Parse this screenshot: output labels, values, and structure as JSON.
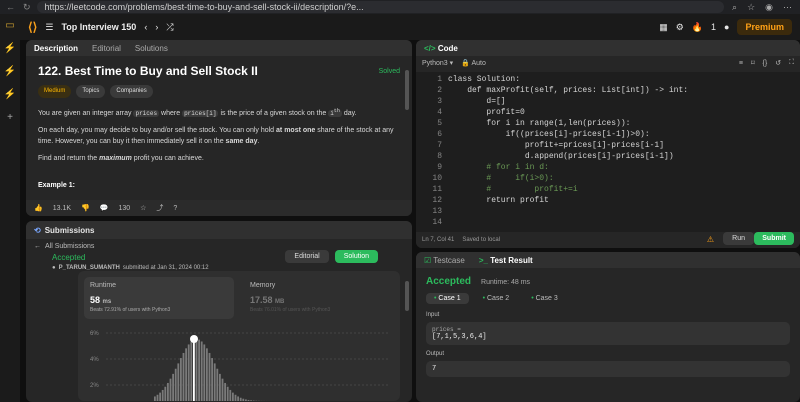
{
  "browser": {
    "url": "https://leetcode.com/problems/best-time-to-buy-and-sell-stock-ii/description/?e..."
  },
  "topnav": {
    "list_title": "Top Interview 150",
    "premium": "Premium",
    "streak": "1"
  },
  "description": {
    "tabs": [
      "Description",
      "Editorial",
      "Solutions"
    ],
    "title": "122. Best Time to Buy and Sell Stock II",
    "solved": "Solved",
    "chips": [
      "Medium",
      "Topics",
      "Companies"
    ],
    "p1a": "You are given an integer array",
    "p1b": "prices",
    "p1c": "where",
    "p1d": "prices[i]",
    "p1e": "is the price of a given stock on the",
    "p1f": "i",
    "p1g": "th",
    "p1h": "day.",
    "p2a": "On each day, you may decide to buy and/or sell the stock. You can only hold",
    "p2b": "at most one",
    "p2c": "share of the stock at any time. However, you can buy it then immediately sell it on the",
    "p2d": "same day",
    "p3a": "Find and return the",
    "p3b": "maximum",
    "p3c": "profit you can achieve.",
    "example": "Example 1:",
    "likes": "13.1K",
    "comments": "130"
  },
  "submissions": {
    "header": "Submissions",
    "back": "All Submissions",
    "accepted": "Accepted",
    "user": "P_TARUN_SUMANTH",
    "submitted": "submitted at Jan 31, 2024 00:12",
    "editorial_btn": "Editorial",
    "solution_btn": "Solution",
    "runtime_label": "Runtime",
    "runtime_val": "58",
    "runtime_unit": "ms",
    "runtime_beats": "Beats 72.91% of users with Python3",
    "memory_label": "Memory",
    "memory_val": "17.58",
    "memory_unit": "MB",
    "memory_beats": "Beats 76.01% of users with Python3",
    "y_ticks": [
      "6%",
      "4%",
      "2%"
    ]
  },
  "code": {
    "header": "Code",
    "lang": "Python3",
    "auto": "Auto",
    "lines": [
      "class Solution:",
      "    def maxProfit(self, prices: List[int]) -> int:",
      "        d=[]",
      "        profit=0",
      "        for i in range(1,len(prices)):",
      "            if((prices[i]-prices[i-1])>0):",
      "                profit+=prices[i]-prices[i-1]",
      "                d.append(prices[i]-prices[i-1])",
      "        # for i in d:",
      "        #     if(i>0):",
      "        #         profit+=i",
      "        return profit",
      "",
      ""
    ],
    "position": "Ln 7, Col 41",
    "saved": "Saved to local",
    "run": "Run",
    "submit": "Submit"
  },
  "result": {
    "tabs": [
      "Testcase",
      "Test Result"
    ],
    "accepted": "Accepted",
    "runtime": "Runtime: 48 ms",
    "cases": [
      "Case 1",
      "Case 2",
      "Case 3"
    ],
    "input_label": "Input",
    "var": "prices =",
    "input_val": "[7,1,5,3,6,4]",
    "output_label": "Output",
    "output_val": "7"
  },
  "colors": {
    "accent": "#ffa116",
    "green": "#2cbb5d"
  }
}
